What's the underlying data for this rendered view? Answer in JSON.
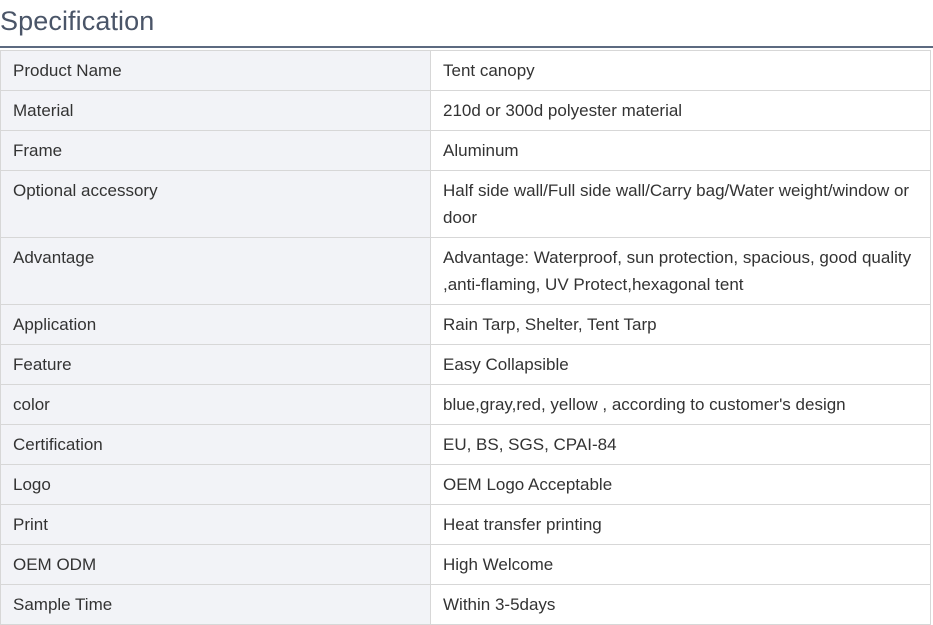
{
  "heading": "Specification",
  "rows": [
    {
      "key": "Product Name",
      "value": "Tent canopy"
    },
    {
      "key": "Material",
      "value": "210d or 300d polyester material"
    },
    {
      "key": "Frame",
      "value": "Aluminum"
    },
    {
      "key": "Optional accessory",
      "value": "Half side wall/Full side wall/Carry bag/Water weight/window or door"
    },
    {
      "key": "Advantage",
      "value": "Advantage: Waterproof, sun protection, spacious, good quality ,anti-flaming, UV Protect,hexagonal tent"
    },
    {
      "key": "Application",
      "value": "Rain Tarp, Shelter, Tent Tarp"
    },
    {
      "key": "Feature",
      "value": "Easy Collapsible"
    },
    {
      "key": "color",
      "value": "blue,gray,red, yellow , according to customer's design"
    },
    {
      "key": "Certification",
      "value": "EU, BS, SGS, CPAI-84"
    },
    {
      "key": "Logo",
      "value": "OEM Logo Acceptable"
    },
    {
      "key": "Print",
      "value": "Heat transfer printing"
    },
    {
      "key": "OEM ODM",
      "value": "High Welcome"
    },
    {
      "key": "Sample Time",
      "value": "Within 3-5days"
    }
  ]
}
